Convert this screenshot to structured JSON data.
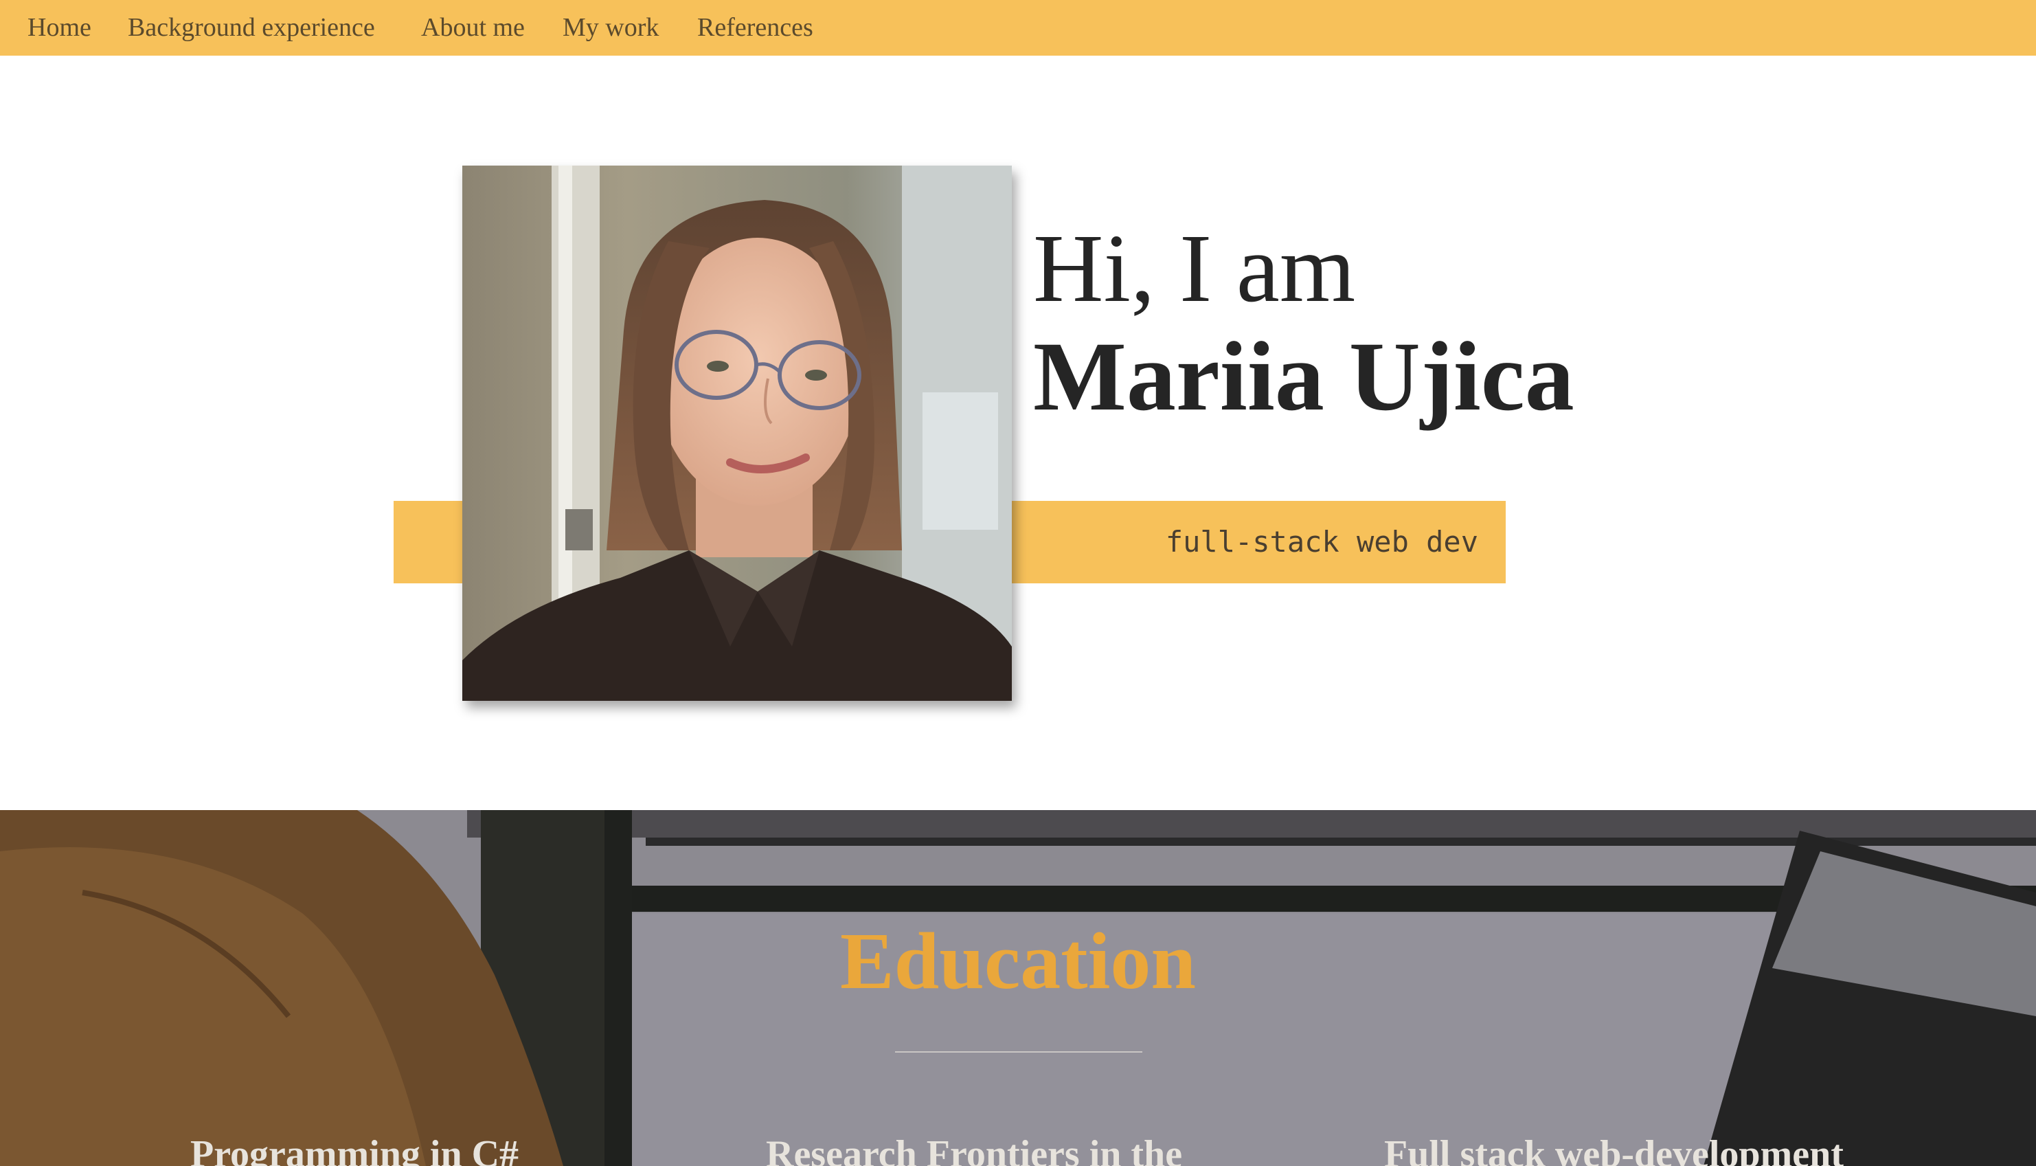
{
  "nav": {
    "items": [
      {
        "label": "Home"
      },
      {
        "label": "Background experience"
      },
      {
        "label": "About me"
      },
      {
        "label": "My work"
      },
      {
        "label": "References"
      }
    ]
  },
  "hero": {
    "greeting": "Hi, I am",
    "name": "Mariia Ujica",
    "tagline": "full-stack web dev"
  },
  "education": {
    "title": "Education",
    "courses": [
      {
        "title": "Programming in C#"
      },
      {
        "title": "Research Frontiers in the"
      },
      {
        "title": "Full stack web-development"
      }
    ]
  },
  "colors": {
    "accent": "#f7c15a",
    "heading_accent": "#eaa73b",
    "text_dark": "#252525"
  }
}
